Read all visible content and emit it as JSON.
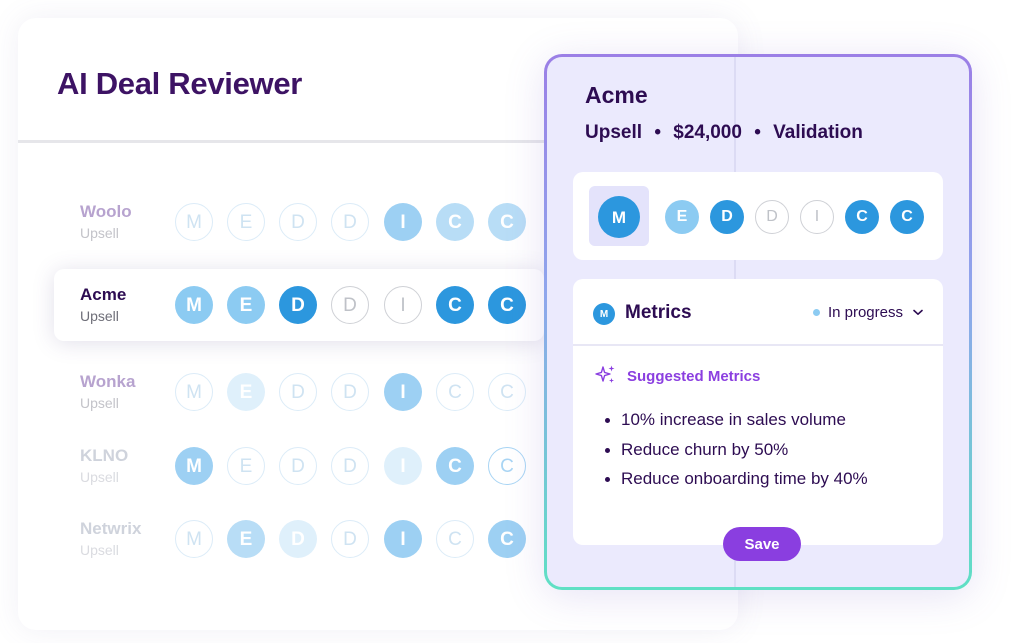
{
  "app": {
    "title": "AI Deal Reviewer"
  },
  "deals": [
    {
      "name": "Woolo",
      "type": "Upsell",
      "letters": [
        "M",
        "E",
        "D",
        "D",
        "I",
        "C",
        "C"
      ]
    },
    {
      "name": "Acme",
      "type": "Upsell",
      "letters": [
        "M",
        "E",
        "D",
        "D",
        "I",
        "C",
        "C"
      ]
    },
    {
      "name": "Wonka",
      "type": "Upsell",
      "letters": [
        "M",
        "E",
        "D",
        "D",
        "I",
        "C",
        "C"
      ]
    },
    {
      "name": "KLNO",
      "type": "Upsell",
      "letters": [
        "M",
        "E",
        "D",
        "D",
        "I",
        "C",
        "C"
      ]
    },
    {
      "name": "Netwrix",
      "type": "Upsell",
      "letters": [
        "M",
        "E",
        "D",
        "D",
        "I",
        "C",
        "C"
      ]
    }
  ],
  "detail": {
    "title": "Acme",
    "subtitle": {
      "type": "Upsell",
      "amount": "$24,000",
      "stage": "Validation",
      "separator": "•"
    },
    "meddicc": [
      "M",
      "E",
      "D",
      "D",
      "I",
      "C",
      "C"
    ],
    "section": {
      "badge": "M",
      "title": "Metrics",
      "status": "In progress",
      "status_icon": "chevron-down-icon",
      "suggested_label": "Suggested Metrics",
      "suggested_icon": "sparkle-icon",
      "items": [
        "10% increase in sales volume",
        "Reduce churn by 50%",
        "Reduce onboarding time by 40%"
      ]
    },
    "save_label": "Save"
  },
  "colors": {
    "brand_dark": "#3d1364",
    "accent_purple": "#8a3ee0",
    "meddicc_complete": "#2c97de",
    "meddicc_partial": "#8ccbf2",
    "panel_bg": "#ebeafd",
    "panel_border_top": "#9b7fe6",
    "panel_border_bottom": "#5fe0c4"
  }
}
